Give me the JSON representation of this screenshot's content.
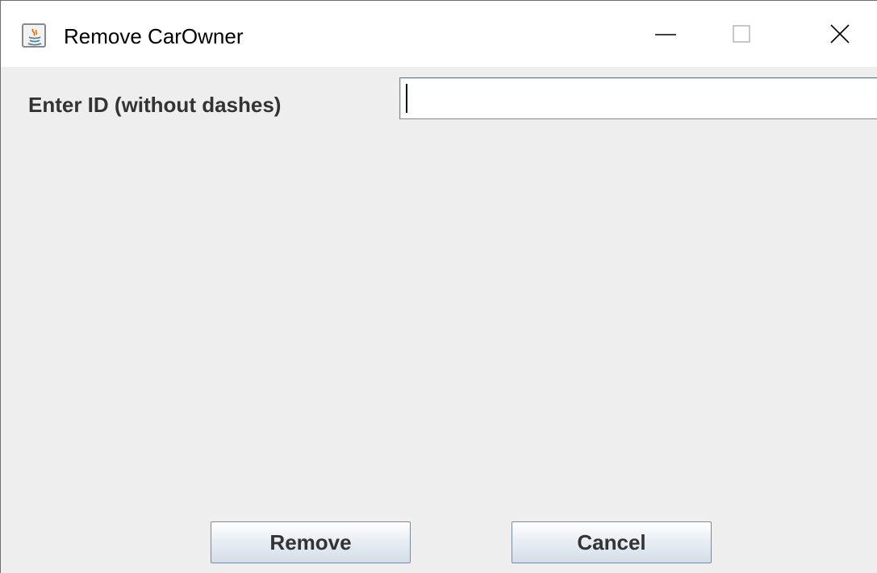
{
  "window": {
    "title": "Remove CarOwner",
    "controls": {
      "minimize": "minimize-icon",
      "maximize": "maximize-icon",
      "close": "close-icon"
    }
  },
  "form": {
    "id_label": "Enter ID (without dashes)",
    "id_value": "",
    "id_placeholder": ""
  },
  "buttons": {
    "remove_label": "Remove",
    "cancel_label": "Cancel"
  },
  "colors": {
    "content_background": "#eeeeee",
    "titlebar_background": "#ffffff",
    "label_text": "#333333",
    "button_border": "#7a8a99"
  }
}
